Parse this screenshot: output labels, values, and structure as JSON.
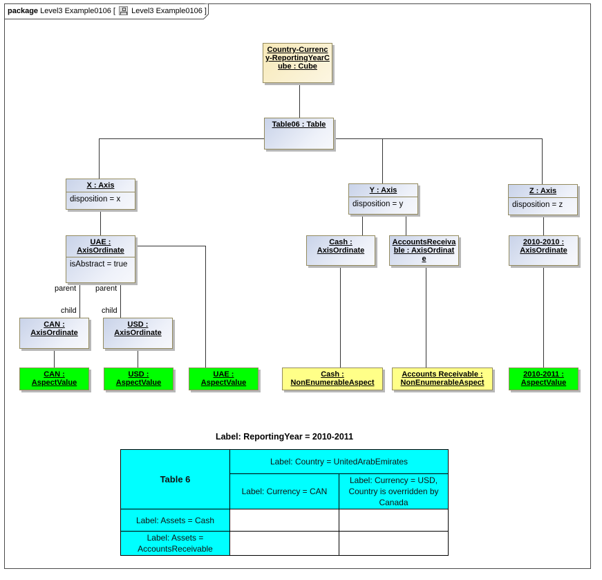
{
  "frame": {
    "keyword": "package",
    "name": "Level3 Example0106",
    "diagram_icon": "class-diagram-icon",
    "diagram_name": "Level3 Example0106"
  },
  "nodes": {
    "cube": {
      "title": "Country-Currency-ReportingYearCube : Cube"
    },
    "table06": {
      "title": "Table06 : Table"
    },
    "x_axis": {
      "title": "X : Axis",
      "attr": "disposition = x"
    },
    "y_axis": {
      "title": "Y : Axis",
      "attr": "disposition = y"
    },
    "z_axis": {
      "title": "Z : Axis",
      "attr": "disposition = z"
    },
    "uae_ord": {
      "title": "UAE : AxisOrdinate",
      "attr": "isAbstract = true"
    },
    "can_ord": {
      "title": "CAN : AxisOrdinate"
    },
    "usd_ord": {
      "title": "USD : AxisOrdinate"
    },
    "cash_ord": {
      "title": "Cash : AxisOrdinate"
    },
    "ar_ord": {
      "title": "AccountsReceivable : AxisOrdinate"
    },
    "y2010_ord": {
      "title": "2010-2010 : AxisOrdinate"
    },
    "can_val": {
      "title": "CAN : AspectValue"
    },
    "usd_val": {
      "title": "USD : AspectValue"
    },
    "uae_val": {
      "title": "UAE : AspectValue"
    },
    "cash_asp": {
      "title": "Cash : NonEnumerableAspect"
    },
    "ar_asp": {
      "title": "Accounts Receivable : NonEnumerableAspect"
    },
    "y2011_val": {
      "title": "2010-2011 : AspectValue"
    }
  },
  "roles": {
    "parent_left": "parent",
    "parent_right": "parent",
    "child_left": "child",
    "child_right": "child"
  },
  "table": {
    "caption": "Label: ReportingYear = 2010-2011",
    "corner": "Table 6",
    "country_header": "Label: Country = UnitedArabEmirates",
    "col1": "Label: Currency = CAN",
    "col2": "Label: Currency = USD, Country is overridden by Canada",
    "row1": "Label: Assets = Cash",
    "row2": "Label: Assets = AccountsReceivable",
    "cells": [
      [
        "",
        ""
      ],
      [
        "",
        ""
      ]
    ]
  },
  "colors": {
    "instance_fill": "#dde3f2",
    "cube_fill": "#fbf1cc",
    "aspect_value_fill": "#00ff00",
    "non_enumerable_fill": "#ffff88",
    "table_header_fill": "#00ffff"
  }
}
